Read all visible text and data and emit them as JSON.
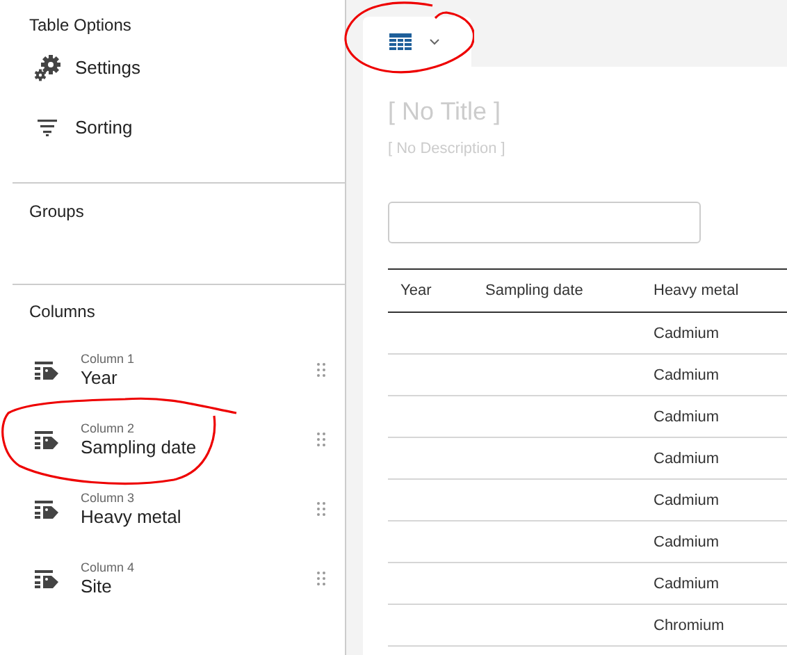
{
  "sidebar": {
    "title": "Table Options",
    "options": [
      {
        "kind": "settings",
        "label": "Settings"
      },
      {
        "kind": "sorting",
        "label": "Sorting"
      }
    ],
    "groups": {
      "title": "Groups"
    },
    "columns": {
      "title": "Columns",
      "items": [
        {
          "caption": "Column 1",
          "name": "Year",
          "highlighted": false
        },
        {
          "caption": "Column 2",
          "name": "Sampling date",
          "highlighted": true
        },
        {
          "caption": "Column 3",
          "name": "Heavy metal",
          "highlighted": false
        },
        {
          "caption": "Column 4",
          "name": "Site",
          "highlighted": false
        }
      ]
    }
  },
  "toolbar": {
    "view_button": {
      "highlighted": true
    }
  },
  "content": {
    "title": "[ No Title ]",
    "description": "[ No Description ]",
    "table": {
      "columns": [
        "Year",
        "Sampling date",
        "Heavy metal"
      ],
      "rows": [
        [
          "",
          "",
          "Cadmium"
        ],
        [
          "",
          "",
          "Cadmium"
        ],
        [
          "",
          "",
          "Cadmium"
        ],
        [
          "",
          "",
          "Cadmium"
        ],
        [
          "",
          "",
          "Cadmium"
        ],
        [
          "",
          "",
          "Cadmium"
        ],
        [
          "",
          "",
          "Cadmium"
        ],
        [
          "",
          "",
          "Chromium"
        ]
      ]
    }
  }
}
